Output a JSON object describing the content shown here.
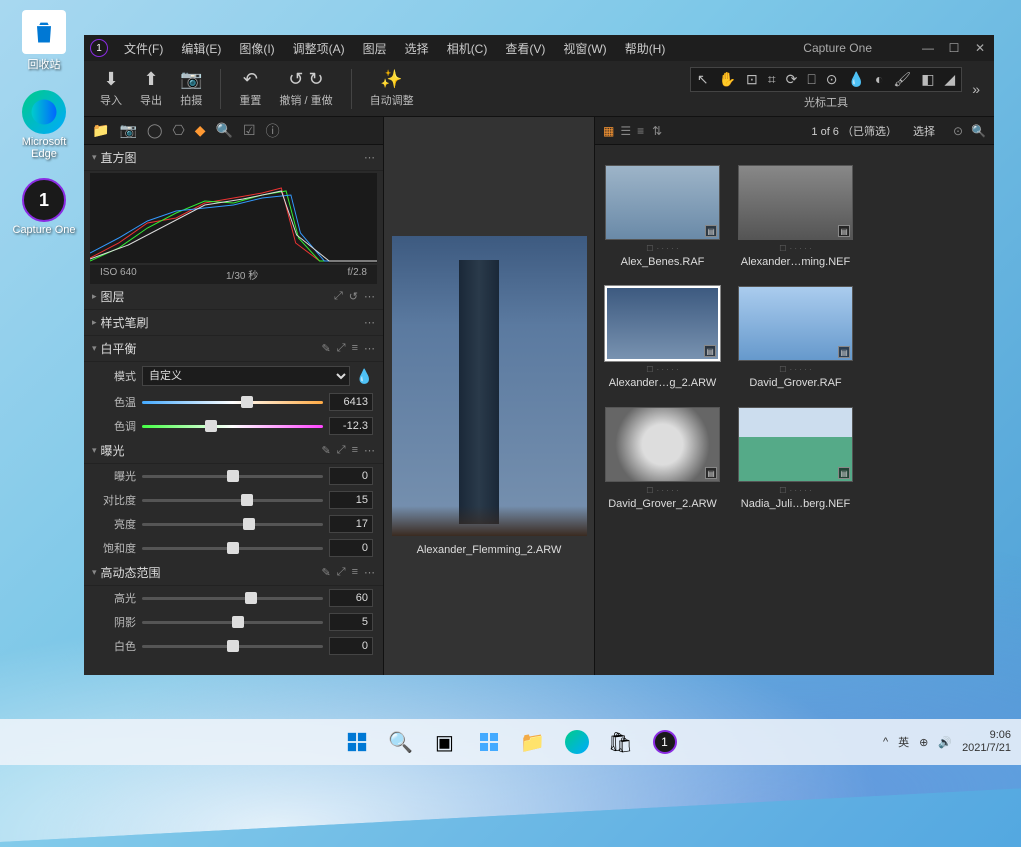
{
  "desktop": {
    "icons": [
      {
        "label": "回收站"
      },
      {
        "label": "Microsoft\nEdge"
      },
      {
        "label": "Capture One"
      }
    ]
  },
  "app": {
    "title": "Capture One",
    "menubar": [
      "文件(F)",
      "编辑(E)",
      "图像(I)",
      "调整项(A)",
      "图层",
      "选择",
      "相机(C)",
      "查看(V)",
      "视窗(W)",
      "帮助(H)"
    ],
    "toolbar": {
      "import": "导入",
      "export": "导出",
      "capture": "拍摄",
      "reset": "重置",
      "undo_redo": "撤销 / 重做",
      "auto": "自动调整",
      "cursor_label": "光标工具"
    },
    "left_tabs": [
      "📁",
      "📷",
      "◯",
      "⎔",
      "◆",
      "🔍",
      "☑",
      "ⓘ"
    ],
    "histogram": {
      "title": "直方图",
      "iso": "ISO 640",
      "shutter": "1/30 秒",
      "aperture": "f/2.8"
    },
    "layers": {
      "title": "图层"
    },
    "style_brush": {
      "title": "样式笔刷"
    },
    "white_balance": {
      "title": "白平衡",
      "mode_label": "模式",
      "mode_value": "自定义",
      "temp_label": "色温",
      "temp_value": "6413",
      "tint_label": "色调",
      "tint_value": "-12.3"
    },
    "exposure": {
      "title": "曝光",
      "exposure_label": "曝光",
      "exposure_value": "0",
      "contrast_label": "对比度",
      "contrast_value": "15",
      "brightness_label": "亮度",
      "brightness_value": "17",
      "saturation_label": "饱和度",
      "saturation_value": "0"
    },
    "hdr": {
      "title": "高动态范围",
      "highlight_label": "高光",
      "highlight_value": "60",
      "shadow_label": "阴影",
      "shadow_value": "5",
      "white_label": "白色",
      "white_value": "0"
    },
    "viewer": {
      "filename": "Alexander_Flemming_2.ARW"
    },
    "browser": {
      "status": "1 of 6 （已筛选）",
      "select": "选择",
      "thumbs": [
        {
          "name": "Alex_Benes.RAF"
        },
        {
          "name": "Alexander…ming.NEF"
        },
        {
          "name": "Alexander…g_2.ARW"
        },
        {
          "name": "David_Grover.RAF"
        },
        {
          "name": "David_Grover_2.ARW"
        },
        {
          "name": "Nadia_Juli…berg.NEF"
        }
      ]
    }
  },
  "taskbar": {
    "ime": "英",
    "time": "9:06",
    "date": "2021/7/21"
  }
}
